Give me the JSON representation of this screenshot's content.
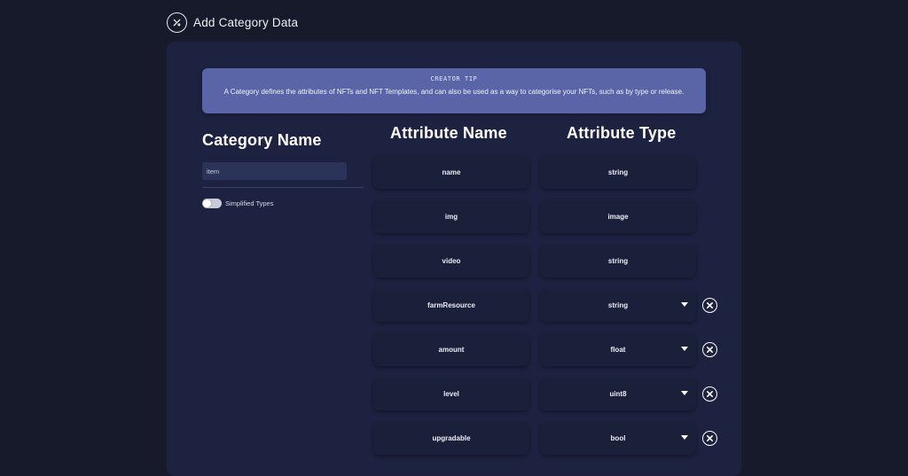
{
  "header": {
    "title": "Add Category Data",
    "icon": "edit-tool-icon"
  },
  "tip": {
    "title": "CREATOR TIP",
    "text": "A Category defines the attributes of NFTs and NFT Templates, and can also be used as a way to categorise your NFTs, such as by type or release."
  },
  "category": {
    "heading": "Category Name",
    "input_value": "item",
    "toggle_label": "Simplified Types",
    "toggle_on": false
  },
  "attributes": {
    "name_heading": "Attribute Name",
    "type_heading": "Attribute Type",
    "rows": [
      {
        "name": "name",
        "type": "string",
        "removable": false
      },
      {
        "name": "img",
        "type": "image",
        "removable": false
      },
      {
        "name": "video",
        "type": "string",
        "removable": false
      },
      {
        "name": "farmResource",
        "type": "string",
        "removable": true
      },
      {
        "name": "amount",
        "type": "float",
        "removable": true
      },
      {
        "name": "level",
        "type": "uint8",
        "removable": true
      },
      {
        "name": "upgradable",
        "type": "bool",
        "removable": true
      }
    ]
  },
  "colors": {
    "background": "#161a2b",
    "panel": "#1d2240",
    "tip": "#5965a6",
    "cell": "#1a1f3a",
    "input": "#2c3358"
  }
}
